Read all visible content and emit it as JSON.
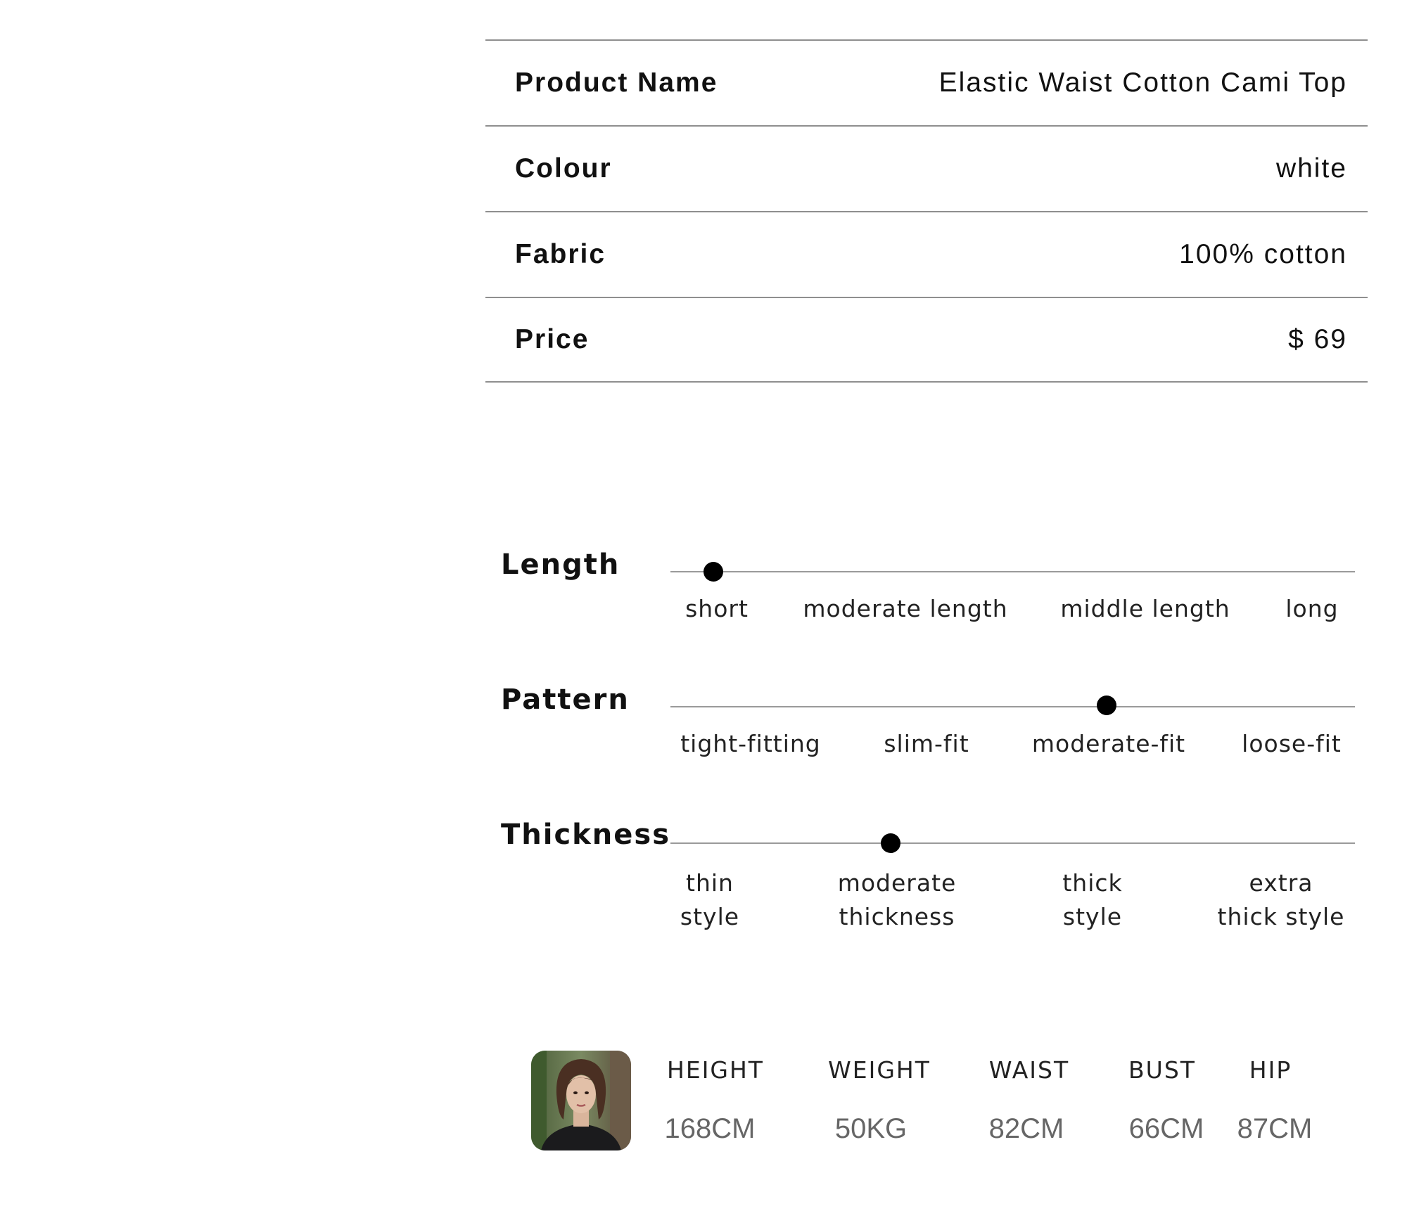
{
  "specs": [
    {
      "label": "Product Name",
      "value": "Elastic Waist Cotton Cami Top"
    },
    {
      "label": "Colour",
      "value": "white"
    },
    {
      "label": "Fabric",
      "value": "100% cotton"
    },
    {
      "label": "Price",
      "value": "$ 69"
    }
  ],
  "attributes": [
    {
      "label": "Length",
      "options": [
        "short",
        "moderate length",
        "middle length",
        "long"
      ],
      "selected": "short"
    },
    {
      "label": "Pattern",
      "options": [
        "tight-fitting",
        "slim-fit",
        "moderate-fit",
        "loose-fit"
      ],
      "selected": "moderate-fit"
    },
    {
      "label": "Thickness",
      "options": [
        "thin\nstyle",
        "moderate\nthickness",
        "thick\nstyle",
        "extra\nthick style"
      ],
      "selected": "moderate\nthickness"
    }
  ],
  "model": {
    "avatar_icon": "model-portrait",
    "measurements": [
      {
        "key": "HEIGHT",
        "value": "168CM"
      },
      {
        "key": "WEIGHT",
        "value": "50KG"
      },
      {
        "key": "WAIST",
        "value": "82CM"
      },
      {
        "key": "BUST",
        "value": "66CM"
      },
      {
        "key": "HIP",
        "value": "87CM"
      }
    ]
  }
}
